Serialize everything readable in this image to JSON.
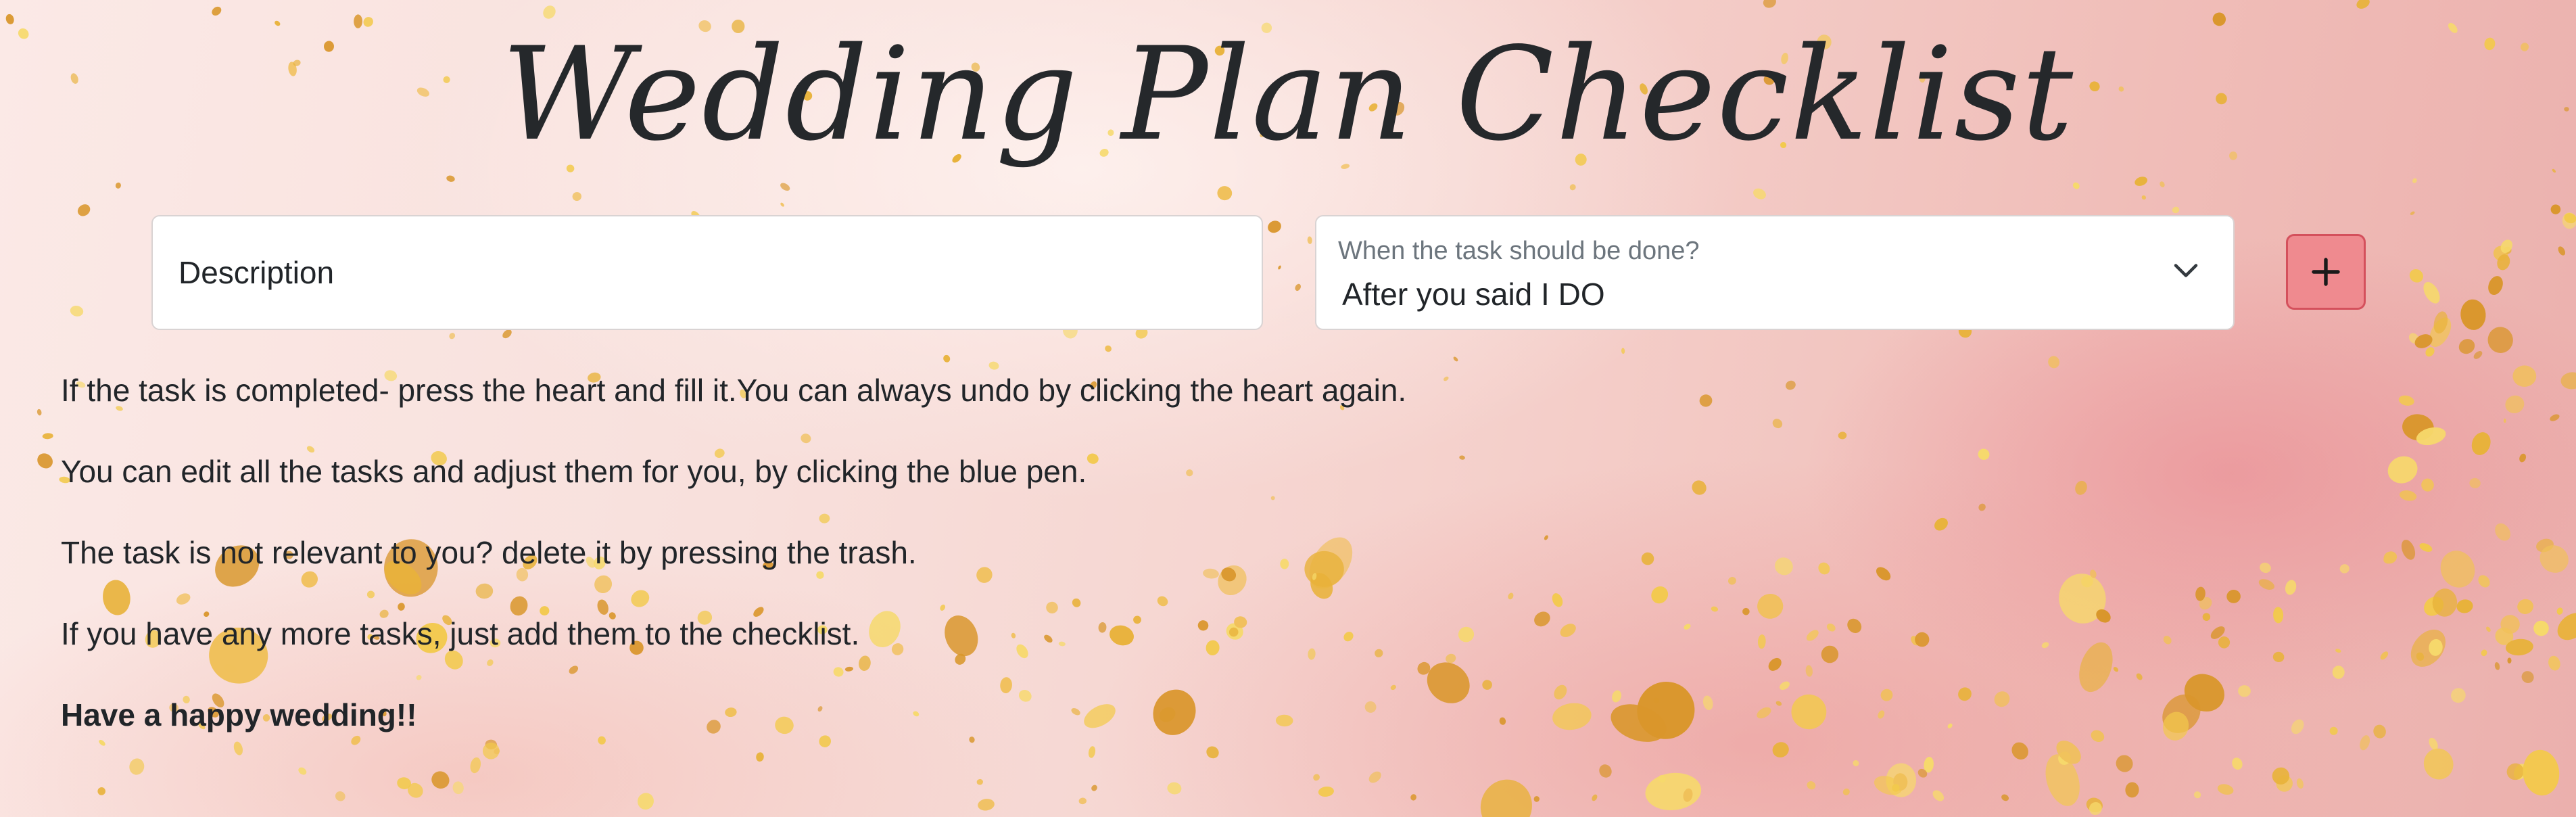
{
  "page": {
    "title": "Wedding Plan Checklist"
  },
  "form": {
    "description_placeholder": "Description",
    "description_value": "",
    "when_label": "When the task should be done?",
    "when_value": "After you said I DO",
    "add_button_label": "+"
  },
  "instructions": [
    "If the task is completed- press the heart and fill it.You can always undo by clicking the heart again.",
    "You can edit all the tasks and adjust them for you, by clicking the blue pen.",
    "The task is not relevant to you? delete it by pressing the trash.",
    "If you have any more tasks, just add them to the checklist.",
    "Have a happy wedding!!"
  ],
  "icons": {
    "select_chevron": "chevron-down-icon",
    "add": "plus-icon"
  },
  "colors": {
    "background_light": "#fbe9e6",
    "background_dark": "#ebb0ad",
    "add_button_fill": "#ef8a8f",
    "add_button_border": "#d4505c",
    "text": "#212529",
    "gold_speckle": "#f2c94c"
  }
}
